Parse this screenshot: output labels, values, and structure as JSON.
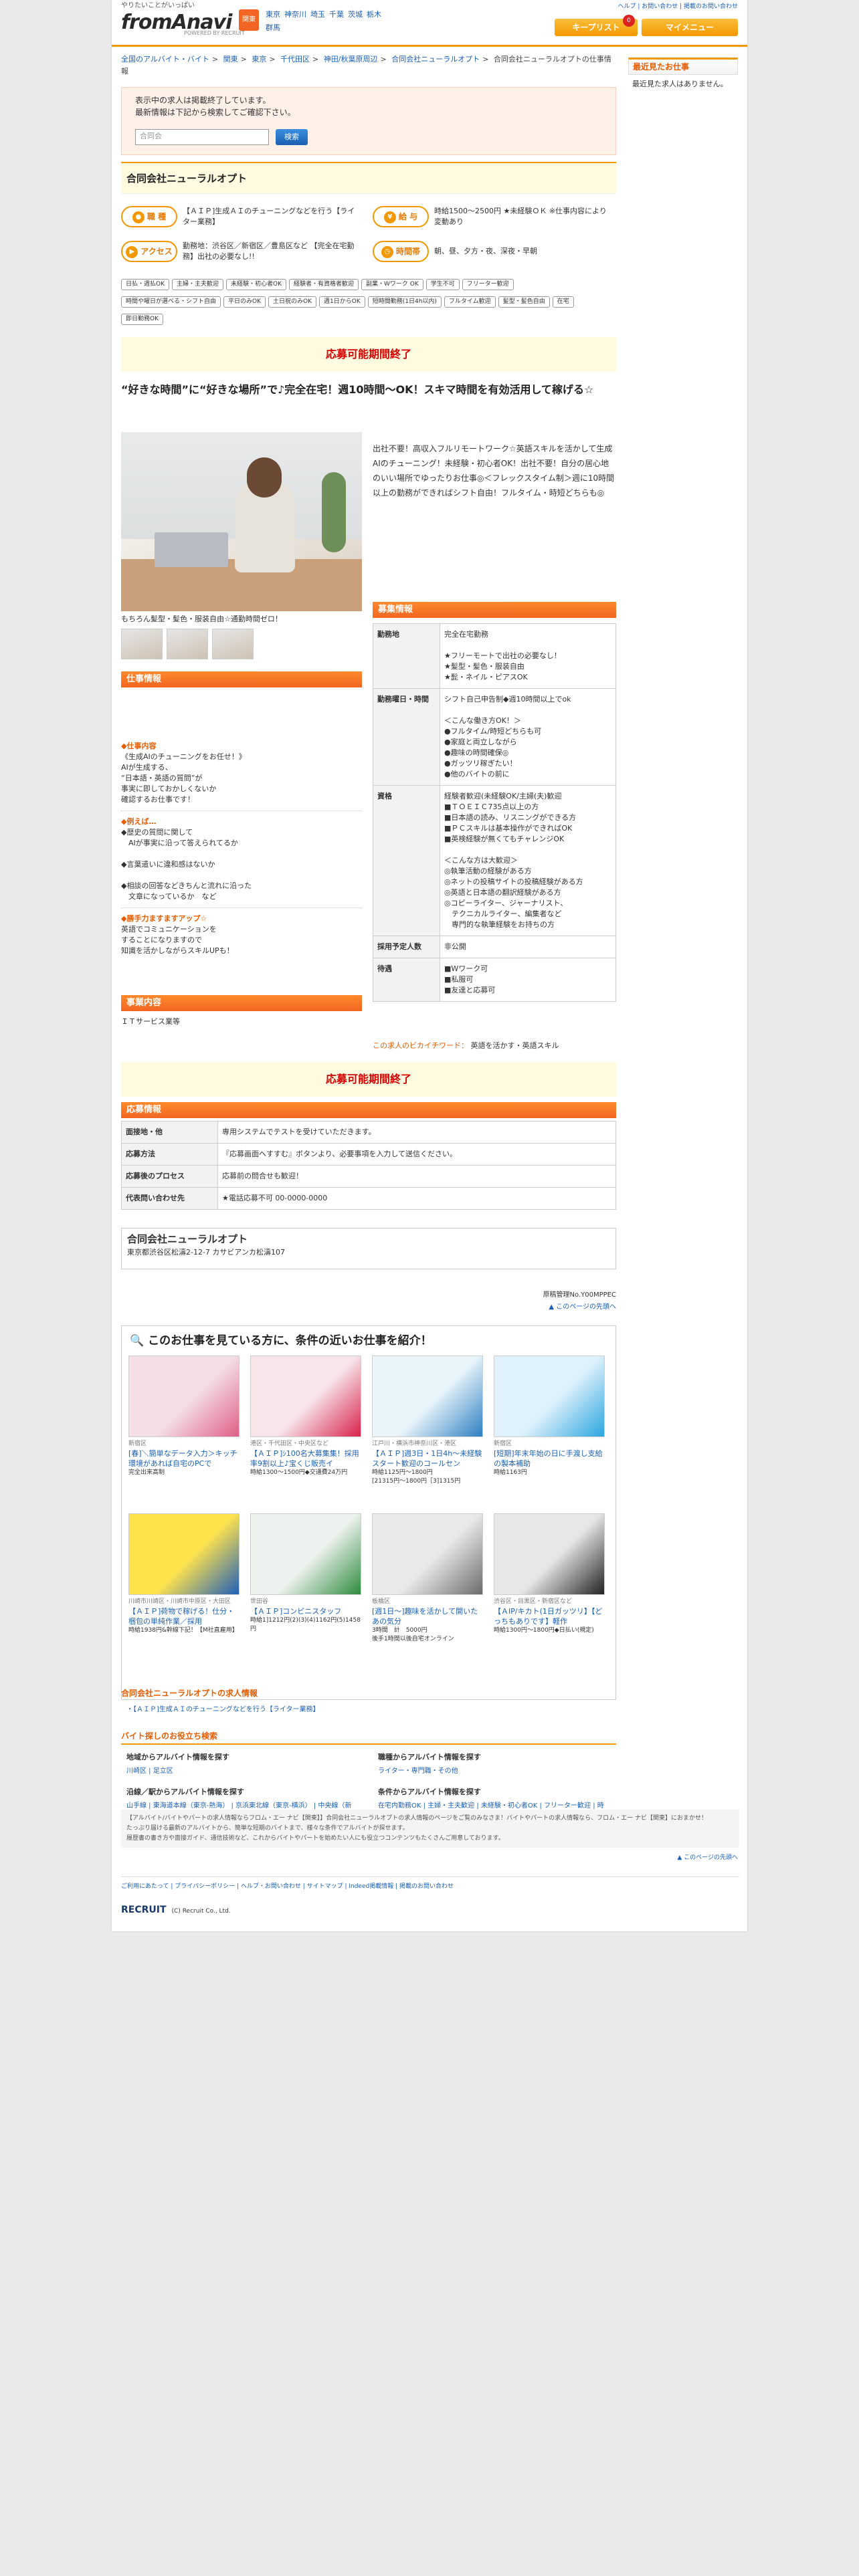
{
  "header": {
    "tagline": "やりたいことがいっぱい",
    "logo": "fromAnavi",
    "logo_sub": "POWERED BY RECRUIT",
    "area_badge": "関東",
    "area_links": [
      "東京",
      "神奈川",
      "埼玉",
      "千葉",
      "茨城",
      "栃木",
      "群馬"
    ],
    "top_links": "ヘルプ | お問い合わせ | 掲載のお問い合わせ",
    "keep_label": "キープリスト",
    "keep_count": "0",
    "my_label": "マイメニュー"
  },
  "breadcrumb": [
    "全国のアルバイト・バイト",
    "関東",
    "東京",
    "千代田区",
    "神田/秋葉原周辺",
    "合同会社ニューラルオプト",
    "合同会社ニューラルオプトの仕事情報"
  ],
  "notice": {
    "line1": "表示中の求人は掲載終了しています。",
    "line2": "最新情報は下記から検索してご確認下さい。",
    "input_value": "合同会",
    "button": "検索"
  },
  "company_name": "合同会社ニューラルオプト",
  "summary": {
    "job_label": "職 種",
    "job_text": "【ＡＩＰ]生成ＡＩのチューニングなどを行う【ライター業務】",
    "pay_label": "給 与",
    "pay_text": "時給1500～2500円 ★未経験ＯＫ ※仕事内容により変動あり",
    "access_label": "アクセス",
    "access_text": "勤務地：渋谷区／新宿区／豊島区など 【完全在宅勤務】出社の必要なし!!",
    "time_label": "時間帯",
    "time_text": "朝、昼、夕方・夜、深夜・早朝"
  },
  "tags": [
    "日払・週払OK",
    "主婦・主夫歓迎",
    "未経験・初心者OK",
    "経験者・有資格者歓迎",
    "副業・Wワーク OK",
    "学生不可",
    "フリーター歓迎",
    "時間や曜日が選べる・シフト自由",
    "平日のみOK",
    "土日祝のみOK",
    "週1日からOK",
    "短時間勤務(1日4h以内)",
    "フルタイム歓迎",
    "髪型・髪色自由",
    "在宅",
    "即日勤務OK"
  ],
  "expired_label": "応募可能期間終了",
  "job_title": "“好きな時間”に“好きな場所”で♪完全在宅！週10時間〜OK！スキマ時間を有効活用して稼げる☆",
  "photo_caption": "もちろん髪型・髪色・服装自由☆通勤時間ゼロ！",
  "intro": "出社不要！高収入フルリモートワーク☆英語スキルを活かして生成AIのチューニング！未経験・初心者OK！出社不要！自分の居心地のいい場所でゆったりお仕事◎＜フレックスタイム制＞週に10時間以上の勤務ができればシフト自由！フルタイム・時短どちらも◎",
  "job_section_label": "仕事情報",
  "job_info": [
    {
      "h": "◆仕事内容",
      "b": "《生成AIのチューニングをお任せ！》\nAIが生成する、\n“日本語・英語の質問”が\n事実に即しておかしくないか\n確認するお仕事です！"
    },
    {
      "h": "◆例えば…",
      "b": "◆歴史の質問に関して\n　AIが事実に沿って答えられてるか\n\n◆言葉遣いに違和感はないか\n\n◆相談の回答などきちんと流れに沿った\n　文章になっているか　など"
    },
    {
      "h": "◆勝手力ますますアップ☆",
      "b": "英語でコミュニケーションを\nすることになりますので\n知識を活かしながらスキルUPも！"
    }
  ],
  "biz_label": "事業内容",
  "biz_text": "ＩＴサービス業等",
  "recruit_label": "募集情報",
  "recruit_rows": [
    {
      "k": "勤務地",
      "v": "完全在宅勤務\n\n★フリーモートで出社の必要なし！\n★髪型・髪色・服装自由\n★髭・ネイル・ピアスOK"
    },
    {
      "k": "勤務曜日・時間",
      "v": "シフト自己申告制◆週10時間以上でok\n\n＜こんな働き方OK！＞\n●フルタイム/時短どちらも可\n●家庭と両立しながら\n●趣味の時間確保◎\n●ガッツリ稼ぎたい！\n●他のバイトの前に"
    },
    {
      "k": "資格",
      "v": "経験者歓迎(未経験OK/主婦(夫)歓迎\n■ＴＯＥＩＣ735点以上の方\n■日本語の読み、リスニングができる方\n■ＰＣスキルは基本操作ができればOK\n■英検経験が無くてもチャレンジOK\n\n＜こんな方は大歓迎＞\n◎執筆活動の経験がある方\n◎ネットの投稿サイトの投稿経験がある方\n◎英語と日本語の翻訳経験がある方\n◎コピーライター、ジャーナリスト、\n　テクニカルライター、編集者など\n　専門的な執筆経験をお持ちの方"
    },
    {
      "k": "採用予定人数",
      "v": "非公開"
    },
    {
      "k": "待遇",
      "v": "■Wワーク可\n■私服可\n■友達と応募可"
    }
  ],
  "skill_label": "この求人のビカイチワード：",
  "skill_value": "英語を活かす・英語スキル",
  "apply_label": "応募情報",
  "apply_rows": [
    {
      "k": "面接地・他",
      "v": "専用システムでテストを受けていただきます。"
    },
    {
      "k": "応募方法",
      "v": "『応募画面へすすむ』ボタンより、必要事項を入力して送信ください。"
    },
    {
      "k": "応募後のプロセス",
      "v": "応募前の問合せも歓迎！"
    },
    {
      "k": "代表問い合わせ先",
      "v": "★電話応募不可 00-0000-0000"
    }
  ],
  "company_addr": "東京都渋谷区松濤2-12-7 カサビアンカ松濤107",
  "mgmt_no": "原稿管理No.Y00MPPEC",
  "page_top": "▲ このページの先頭へ",
  "similar_title": "このお仕事を見ている方に、条件の近いお仕事を紹介！",
  "similar_cards": [
    {
      "loc": "新宿区",
      "title": "[春]＼簡単なデータ入力＞キッチ環境があれば自宅のPCで",
      "wage": "完全出来高制",
      "color": "#f4dfe6",
      "hint": "#e05f86"
    },
    {
      "loc": "港区・千代田区・中央区など",
      "title": "【ＡＩＰ]ｼ100名大募集集！採用率9割以上♪宝くじ販売イ",
      "wage": "時給1300〜1500円◆交通費24万円",
      "color": "#f7e5ea",
      "hint": "#d8214a"
    },
    {
      "loc": "江戸川・横浜市神奈川区・港区",
      "title": "【ＡＩＰ]週3日・1日4h〜未経験スタート歓迎のコールセン",
      "wage": "時給1125円〜1800円\n[21315円〜1800円［3]1315円",
      "color": "#e9f4fb",
      "hint": "#2d7fc1"
    },
    {
      "loc": "新宿区",
      "title": "[短期]年末年始の日に手渡し支給の製本補助",
      "wage": "時給1163円",
      "color": "#dff1fb",
      "hint": "#2aa6e0"
    },
    {
      "loc": "川崎市川崎区・川崎市中原区・大田区",
      "title": "【ＡＩＰ]荷物で稼げる！仕分・梱包の単純作業／採用",
      "wage": "時給1938円&幹線下記！【M社直雇用】",
      "color": "#ffe34d",
      "hint": "#1f5fb8"
    },
    {
      "loc": "世田谷",
      "title": "【ＡＩＰ]コンビニスタッフ",
      "wage": "時給1]1212円(2)(3)(4)1162円(5)1458円",
      "color": "#eef2ee",
      "hint": "#2e8b3e"
    },
    {
      "loc": "板橋区",
      "title": "[週1日～]趣味を活かして開いたあの気分",
      "wage": "3時間　計　5000円\n後手1時間以後自宅オンライン",
      "color": "#eceae8",
      "hint": "#6b6b6b"
    },
    {
      "loc": "渋谷区・目黒区・新宿区など",
      "title": "【ＡIP/キカト(1日ガッツリ】【どっちもありです】軽作",
      "wage": "時給1300円〜1800円◆日払い(規定)",
      "color": "#e7e7e7",
      "hint": "#222222"
    }
  ],
  "related_head": "合同会社ニューラルオプトの求人情報",
  "related_item": "・【ＡＩＰ]生成ＡＩのチューニングなどを行う【ライター業務】",
  "search_head": "バイト探しのお役立ち検索",
  "search_groups": [
    {
      "h": "地域からアルバイト情報を探す",
      "l": "川崎区 | 足立区"
    },
    {
      "h": "職種からアルバイト情報を探す",
      "l": "ライター・専門職・その他"
    },
    {
      "h": "沿線／駅からアルバイト情報を探す",
      "l": "山手線 | 東海道本線（東京-熱海） | 京浜東北線（東京-横浜） | 中央線（新宿-高尾） | 東京メトロ丸ノ内線 | 横浜駅 | 新宿駅 | 渋谷駅 | 池袋駅 | 川崎駅"
    },
    {
      "h": "条件からアルバイト情報を探す",
      "l": "在宅内勤務OK | 主婦・主夫歓迎 | 未経験・初心者OK | フリーター歓迎 | 時間や曜日が選べる・シフト自由"
    }
  ],
  "foot_desc": "【アルバイト/バイトやパートの求人情報ならフロム・エー ナビ【関東】】合同会社ニューラルオプトの求人情報のページをご覧のみなさま！バイトやパートの求人情報なら、フロム・エー ナビ【関東】におまかせ！\nたっぷり届ける最新のアルバイトから、簡単な短期のバイトまで、様々な条件でアルバイトが探せます。\n履歴書の書き方や面接ガイド、通信技術など、これからバイトやパートを始めたい人にも役立つコンテンツもたくさんご用意しております。",
  "foot_top": "▲ このページの先頭へ",
  "foot_links": "ご利用にあたって | プライバシーポリシー | ヘルプ・お問い合わせ | サイトマップ | Indeed掲載情報 | 掲載のお問い合わせ",
  "foot_logo": "RECRUIT",
  "foot_copy": "(C) Recruit Co., Ltd.",
  "side": {
    "head": "最近見たお仕事",
    "body": "最近見た求人はありません。"
  }
}
